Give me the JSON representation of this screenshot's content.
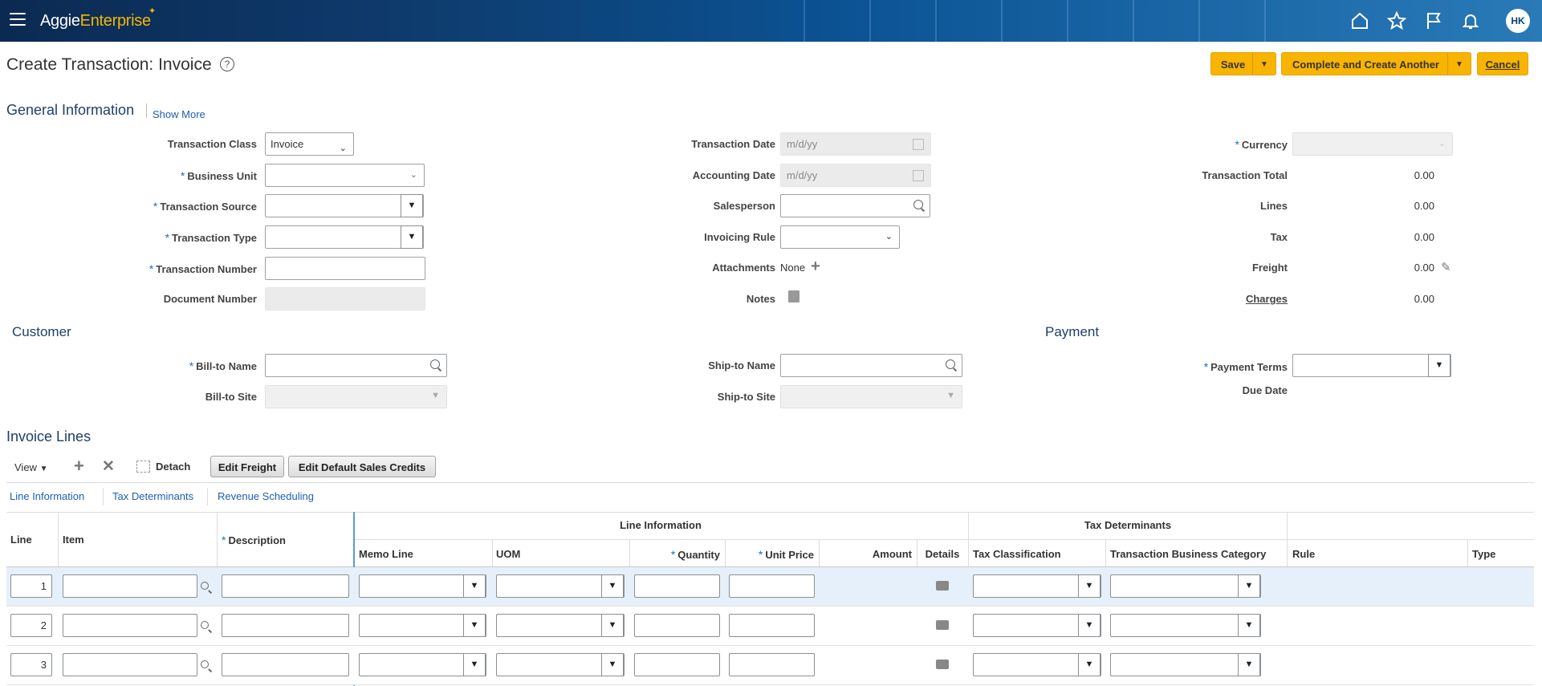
{
  "header": {
    "app_name_part1": "Aggie",
    "app_name_part2": "Enterprise",
    "user_initials": "HK",
    "icons": [
      "menu-icon",
      "home-icon",
      "star-icon",
      "flag-icon",
      "bell-icon"
    ]
  },
  "page": {
    "title": "Create Transaction: Invoice",
    "help": "?",
    "save_label": "Save",
    "complete_label": "Complete and Create Another",
    "cancel_label": "Cancel"
  },
  "general": {
    "title": "General Information",
    "show_more": "Show More",
    "transaction_class_label": "Transaction Class",
    "transaction_class_value": "Invoice",
    "business_unit_label": "Business Unit",
    "transaction_source_label": "Transaction Source",
    "transaction_type_label": "Transaction Type",
    "transaction_number_label": "Transaction Number",
    "document_number_label": "Document Number",
    "transaction_date_label": "Transaction Date",
    "transaction_date_placeholder": "m/d/yy",
    "accounting_date_label": "Accounting Date",
    "accounting_date_placeholder": "m/d/yy",
    "salesperson_label": "Salesperson",
    "invoicing_rule_label": "Invoicing Rule",
    "attachments_label": "Attachments",
    "attachments_value": "None",
    "notes_label": "Notes",
    "currency_label": "Currency",
    "transaction_total_label": "Transaction Total",
    "transaction_total_value": "0.00",
    "lines_label": "Lines",
    "lines_value": "0.00",
    "tax_label": "Tax",
    "tax_value": "0.00",
    "freight_label": "Freight",
    "freight_value": "0.00",
    "charges_label": "Charges",
    "charges_value": "0.00"
  },
  "customer": {
    "title": "Customer",
    "bill_to_name_label": "Bill-to Name",
    "bill_to_site_label": "Bill-to Site",
    "ship_to_name_label": "Ship-to Name",
    "ship_to_site_label": "Ship-to Site"
  },
  "payment": {
    "title": "Payment",
    "payment_terms_label": "Payment Terms",
    "due_date_label": "Due Date"
  },
  "lines": {
    "title": "Invoice Lines",
    "view_label": "View",
    "detach_label": "Detach",
    "edit_freight_label": "Edit Freight",
    "edit_sales_credits_label": "Edit Default Sales Credits",
    "tabs": [
      "Line Information",
      "Tax Determinants",
      "Revenue Scheduling"
    ],
    "group_line_info": "Line Information",
    "group_tax": "Tax Determinants",
    "columns": {
      "line": "Line",
      "item": "Item",
      "description": "Description",
      "memo_line": "Memo Line",
      "uom": "UOM",
      "quantity": "Quantity",
      "unit_price": "Unit Price",
      "amount": "Amount",
      "details": "Details",
      "tax_classification": "Tax Classification",
      "transaction_business_category": "Transaction Business Category",
      "rule": "Rule",
      "type": "Type"
    },
    "rows": [
      {
        "line": "1"
      },
      {
        "line": "2"
      },
      {
        "line": "3"
      }
    ]
  }
}
